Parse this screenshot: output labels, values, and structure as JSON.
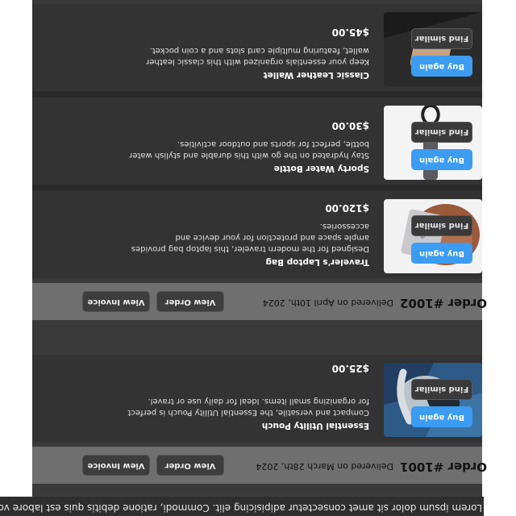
{
  "intro_text": "Lorem ipsum dolor sit amet consectetur adipisicing elit. Commodi, ratione debitis quis est labore voluptatibus!",
  "orders": [
    {
      "title": "Order #1001",
      "delivered": "Delivered on March 28th, 2024",
      "view_order": "View Order",
      "view_invoice": "View Invoice",
      "items": [
        {
          "name": "Essential Utility Pouch",
          "description": "Compact and versatile, the Essential Utility Pouch is perfect for organizing small items. Ideal for daily use or travel.",
          "price": "$25.00",
          "buy_again": "Buy again",
          "find_similar": "Find similar"
        }
      ]
    },
    {
      "title": "Order #1002",
      "delivered": "Delivered on April 10th, 2024",
      "view_order": "View Order",
      "view_invoice": "View Invoice",
      "items": [
        {
          "name": "Traveler's Laptop Bag",
          "description": "Designed for the modern traveler, this laptop bag provides ample space and protection for your device and accessories.",
          "price": "$120.00",
          "buy_again": "Buy again",
          "find_similar": "Find similar"
        },
        {
          "name": "Sporty Water Bottle",
          "description": "Stay hydrated on the go with this durable and stylish water bottle, perfect for sports and outdoor activities.",
          "price": "$30.00",
          "buy_again": "Buy again",
          "find_similar": "Find similar"
        },
        {
          "name": "Classic Leather Wallet",
          "description": "Keep your essentials organized with this classic leather wallet, featuring multiple card slots and a coin pocket.",
          "price": "$45.00",
          "buy_again": "Buy again",
          "find_similar": "Find similar"
        }
      ]
    }
  ]
}
